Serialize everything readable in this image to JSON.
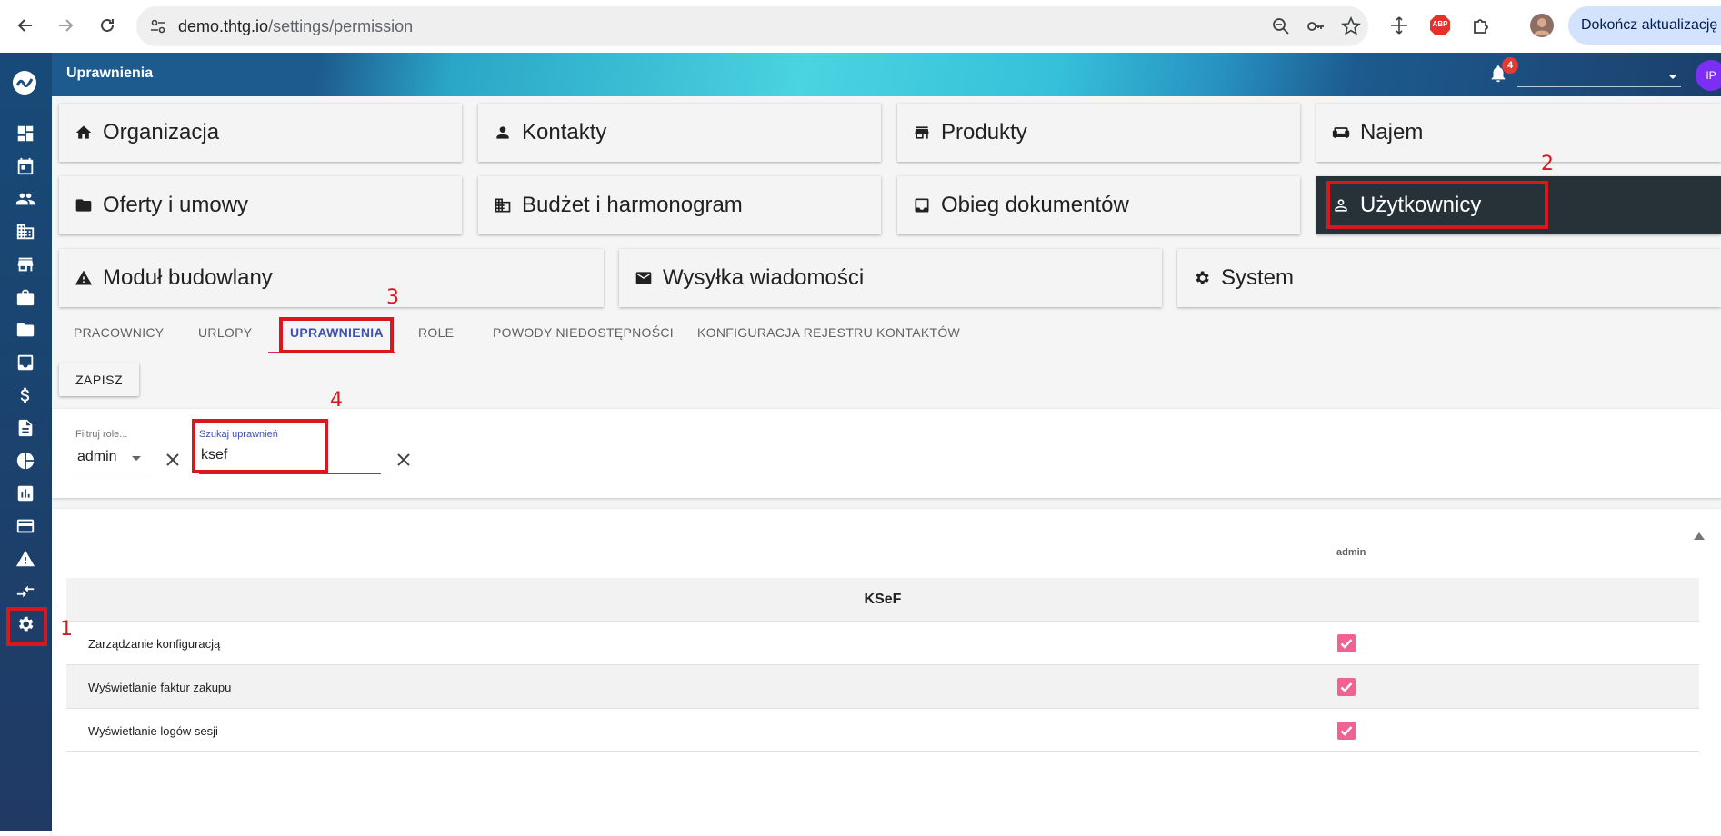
{
  "browser": {
    "url_host": "demo.thtg.io",
    "url_path": "/settings/permission",
    "update_button": "Dokończ aktualizację",
    "extension_abp": "ABP"
  },
  "header": {
    "title": "Uprawnienia",
    "notification_count": "4",
    "avatar_initials": "IP"
  },
  "modules": [
    {
      "label": "Organizacja",
      "icon": "home-icon"
    },
    {
      "label": "Kontakty",
      "icon": "person-icon"
    },
    {
      "label": "Produkty",
      "icon": "store-icon"
    },
    {
      "label": "Najem",
      "icon": "sofa-icon"
    },
    {
      "label": "Oferty i umowy",
      "icon": "folder-icon"
    },
    {
      "label": "Budżet i harmonogram",
      "icon": "building-icon"
    },
    {
      "label": "Obieg dokumentów",
      "icon": "inbox-icon"
    },
    {
      "label": "Użytkownicy",
      "icon": "user-outline-icon"
    },
    {
      "label": "Moduł budowlany",
      "icon": "warning-icon"
    },
    {
      "label": "Wysyłka wiadomości",
      "icon": "mail-icon"
    },
    {
      "label": "System",
      "icon": "gear-icon"
    }
  ],
  "tabs": [
    {
      "label": "PRACOWNICY"
    },
    {
      "label": "URLOPY"
    },
    {
      "label": "UPRAWNIENIA"
    },
    {
      "label": "ROLE"
    },
    {
      "label": "POWODY NIEDOSTĘPNOŚCI"
    },
    {
      "label": "KONFIGURACJA REJESTRU KONTAKTÓW"
    }
  ],
  "save_button": "ZAPISZ",
  "filters": {
    "role_label": "Filtruj role...",
    "role_value": "admin",
    "search_label": "Szukaj uprawnień",
    "search_value": "ksef"
  },
  "table": {
    "column": "admin",
    "group": "KSeF",
    "rows": [
      {
        "label": "Zarządzanie konfiguracją",
        "checked": true
      },
      {
        "label": "Wyświetlanie faktur zakupu",
        "checked": true
      },
      {
        "label": "Wyświetlanie logów sesji",
        "checked": true
      }
    ]
  },
  "annotations": [
    "1",
    "2",
    "3",
    "4"
  ],
  "colors": {
    "active_module": "#263238",
    "tab_active": "#3f51b5",
    "tab_indicator": "#e91e63",
    "checkbox": "#f06292",
    "annotation": "#d7191f"
  }
}
